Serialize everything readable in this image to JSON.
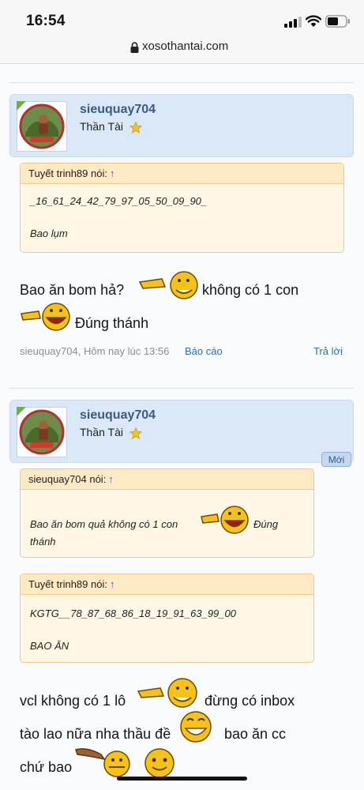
{
  "status": {
    "time": "16:54"
  },
  "browser": {
    "url": "xosothantai.com"
  },
  "posts": [
    {
      "username": "sieuquay704",
      "user_title": "Thần Tài",
      "quotes": [
        {
          "author": "Tuyết trinh89 nói:",
          "lines": [
            "_16_61_24_42_79_97_05_50_09_90_",
            "Bao lụm"
          ]
        }
      ],
      "message": {
        "part1": "Bao ăn bom hả?",
        "part2": "không có 1 con",
        "part3": "Đúng thánh"
      },
      "meta": "sieuquay704, Hôm nay lúc 13:56",
      "report_label": "Báo cáo",
      "reply_label": "Trả lời"
    },
    {
      "username": "sieuquay704",
      "user_title": "Thần Tài",
      "new_badge": "Mới",
      "quotes": [
        {
          "author": "sieuquay704 nói:",
          "lines": [
            "Bao ăn bom quả không có 1 con",
            "Đúng",
            "thánh"
          ]
        },
        {
          "author": "Tuyết trinh89 nói:",
          "lines": [
            "KGTG__78_87_68_86_18_19_91_63_99_00",
            "BAO ĂN"
          ]
        }
      ],
      "message": {
        "l1a": "vcl không có 1 lô",
        "l1b": "đừng có inbox",
        "l2a": "tào lao nữa nha thầu đề",
        "l2b": "bao ăn cc",
        "l3": "chứ bao"
      }
    }
  ]
}
